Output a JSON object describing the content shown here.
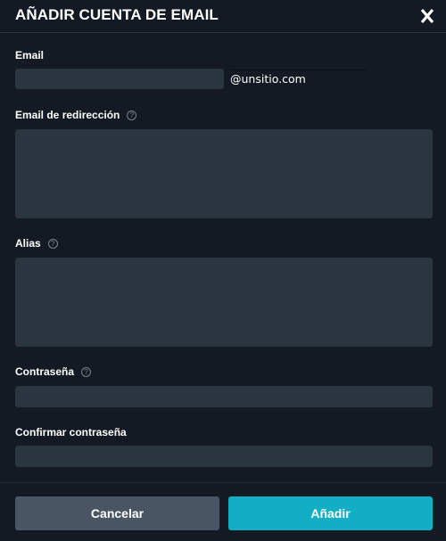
{
  "dialog": {
    "title": "AÑADIR CUENTA DE EMAIL",
    "close_icon": "close-icon"
  },
  "form": {
    "email_label": "Email",
    "email_value": "",
    "email_domain": "@unsitio.com",
    "redirect_label": "Email de redirección",
    "redirect_value": "",
    "alias_label": "Alias",
    "alias_value": "",
    "password_label": "Contraseña",
    "password_value": "",
    "confirm_password_label": "Confirmar contraseña",
    "confirm_password_value": "",
    "help_glyph": "?"
  },
  "footer": {
    "cancel_label": "Cancelar",
    "add_label": "Añadir"
  },
  "colors": {
    "background": "#141a23",
    "field": "#2b353f",
    "cancel": "#4a5563",
    "accent": "#12aec6"
  }
}
